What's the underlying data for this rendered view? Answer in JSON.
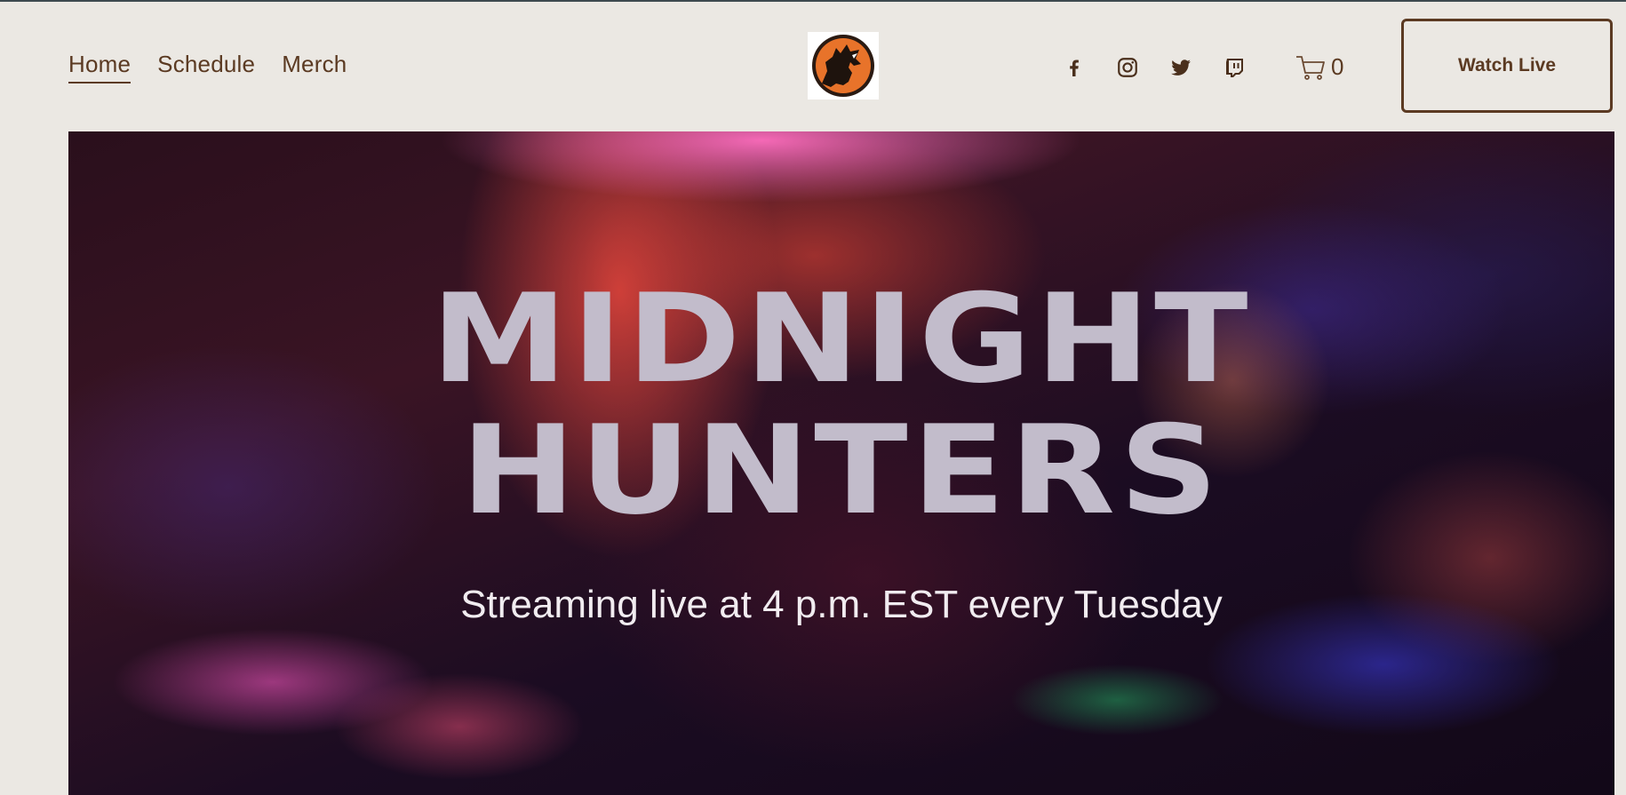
{
  "nav": {
    "items": [
      {
        "label": "Home",
        "active": true
      },
      {
        "label": "Schedule",
        "active": false
      },
      {
        "label": "Merch",
        "active": false
      }
    ]
  },
  "logo": {
    "icon": "howling-wolf-logo"
  },
  "socials": [
    {
      "name": "facebook",
      "icon": "facebook-icon"
    },
    {
      "name": "instagram",
      "icon": "instagram-icon"
    },
    {
      "name": "twitter",
      "icon": "twitter-icon"
    },
    {
      "name": "twitch",
      "icon": "twitch-icon"
    }
  ],
  "cart": {
    "icon": "cart-icon",
    "count": "0"
  },
  "header": {
    "cta_label": "Watch Live"
  },
  "hero": {
    "title_line1": "MIDNIGHT",
    "title_line2": "HUNTERS",
    "subtitle": "Streaming live at 4 p.m. EST every Tuesday"
  },
  "colors": {
    "page_background": "#ebe8e3",
    "accent_brown": "#5b3a22",
    "title_color": "#c2bccb",
    "logo_orange": "#e8732a"
  }
}
